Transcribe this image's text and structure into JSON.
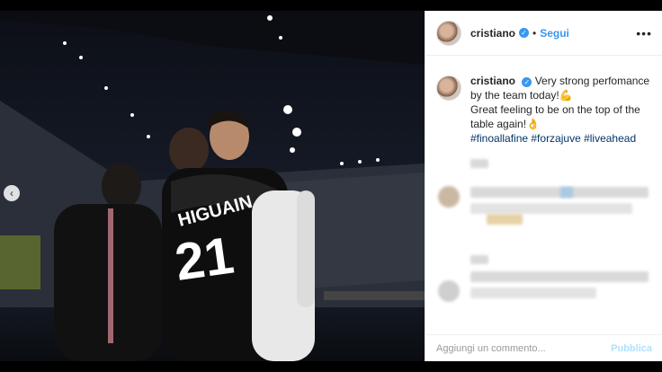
{
  "post": {
    "username": "cristiano",
    "follow_label": "Segui",
    "separator": "•",
    "more_icon": "•••",
    "verified_mark": "✓",
    "caption": {
      "line1": "Very strong perfomance",
      "line2": "by the team today!💪",
      "line3": "Great feeling to be on the top of the",
      "line4": "table again!👌",
      "hashtags": "#finoallafine #forzajuve #liveahead"
    },
    "photo_jersey_name": "HIGUAIN",
    "photo_jersey_number": "21"
  },
  "comment_box": {
    "placeholder": "Aggiungi un commento...",
    "publish_label": "Pubblica"
  },
  "carousel": {
    "prev_icon": "‹"
  },
  "colors": {
    "link": "#3897f0",
    "hashtag": "#003569",
    "publish_disabled": "#b2dffc"
  }
}
